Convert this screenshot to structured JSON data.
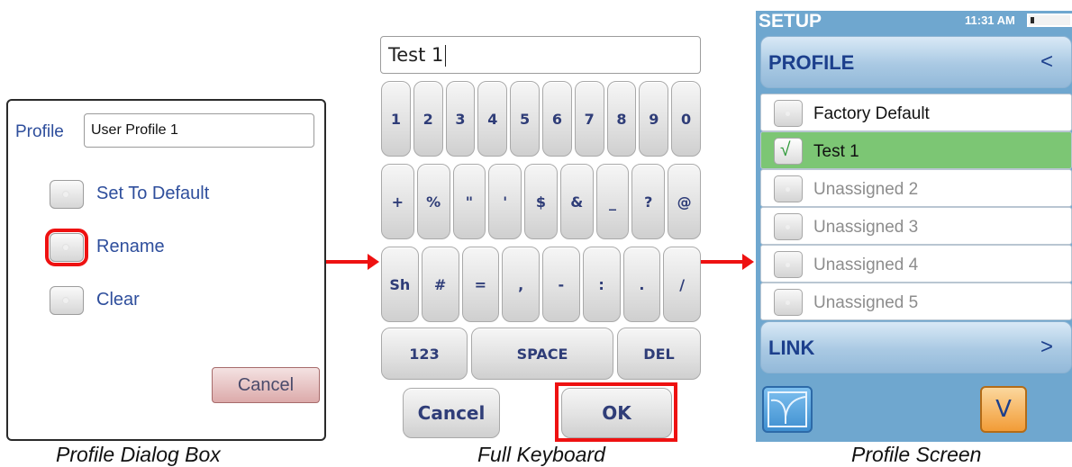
{
  "dialog": {
    "profile_label": "Profile",
    "profile_value": "User Profile 1",
    "options": [
      "Set To Default",
      "Rename",
      "Clear"
    ],
    "cancel_label": "Cancel"
  },
  "keyboard": {
    "input_value": "Test 1",
    "row1": [
      "1",
      "2",
      "3",
      "4",
      "5",
      "6",
      "7",
      "8",
      "9",
      "0"
    ],
    "row2": [
      "+",
      "%",
      "\"",
      "'",
      "$",
      "&",
      "_",
      "?",
      "@"
    ],
    "row3": [
      "Sh",
      "#",
      "=",
      ",",
      "-",
      ":",
      ".",
      "/"
    ],
    "row4": [
      "123",
      "SPACE",
      "DEL"
    ],
    "cancel_label": "Cancel",
    "ok_label": "OK"
  },
  "screen": {
    "title": "SETUP",
    "time": "11:31 AM",
    "profile_bar": "PROFILE",
    "profile_chevron": "<",
    "items": [
      {
        "label": "Factory Default",
        "state": "normal"
      },
      {
        "label": "Test 1",
        "state": "selected"
      },
      {
        "label": "Unassigned 2",
        "state": "unassigned"
      },
      {
        "label": "Unassigned 3",
        "state": "unassigned"
      },
      {
        "label": "Unassigned 4",
        "state": "unassigned"
      },
      {
        "label": "Unassigned 5",
        "state": "unassigned"
      }
    ],
    "check_glyph": "√",
    "link_bar": "LINK",
    "link_chevron": ">",
    "v_label": "V"
  },
  "captions": [
    "Profile Dialog Box",
    "Full Keyboard",
    "Profile Screen"
  ],
  "colors": {
    "highlight": "#ee1111",
    "label_blue": "#2e4e9c",
    "selected_green": "#7cc674",
    "screen_bg": "#6fa7cf"
  }
}
